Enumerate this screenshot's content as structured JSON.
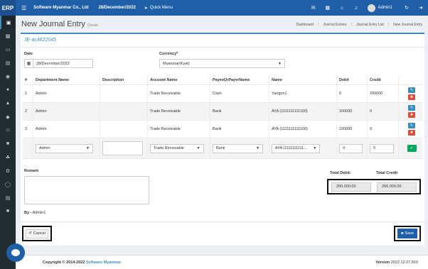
{
  "app": {
    "logo": "ERP",
    "company": "Software Myanmar Co., Ltd",
    "date": "28/December/2022",
    "quick_menu": "Quick Menu",
    "user": "Admin1"
  },
  "page": {
    "title": "New Journal Entry",
    "subtitle": "Create",
    "breadcrumb": [
      "Dashboard",
      "Journal Entries",
      "Journal Entry List",
      "New Journal Entry"
    ]
  },
  "form": {
    "je_code": "JE-ac4622045",
    "date_label": "Date",
    "date_value": "28/December/2022",
    "currency_label": "Currency*",
    "currency_value": "Myanmar(Kyat)"
  },
  "table": {
    "headers": [
      "#",
      "Department Name",
      "Description",
      "Account Name",
      "PayeeOrPayerName",
      "Name",
      "Debit",
      "Credit",
      ""
    ],
    "rows": [
      {
        "no": "1",
        "dept": "Admin",
        "desc": "",
        "account": "Trade Receivable",
        "payee": "Cash",
        "name": "Yangon1",
        "debit": "0",
        "credit": "200000"
      },
      {
        "no": "2",
        "dept": "Admin",
        "desc": "",
        "account": "Trade Receivable",
        "payee": "Bank",
        "name": "AYA (1111111111100)",
        "debit": "100000",
        "credit": "0"
      },
      {
        "no": "3",
        "dept": "Admin",
        "desc": "",
        "account": "Trade Receivable",
        "payee": "Bank",
        "name": "AYA (1111111111100)",
        "debit": "100000",
        "credit": "0"
      }
    ],
    "input_row": {
      "dept": "Admin",
      "account": "Trade Receivable",
      "payee": "Bank",
      "name": "AYA (1111111111...",
      "debit": "0",
      "credit": "0"
    }
  },
  "remark_label": "Remark",
  "totals": {
    "debit_label": "Total Debit:",
    "credit_label": "Total Credit",
    "debit_value": "200,000.00",
    "credit_value": "200,000.00"
  },
  "by": {
    "label": "By -",
    "value": "Admin1"
  },
  "buttons": {
    "cancel": "Cancel",
    "save": "Save"
  },
  "footer": {
    "copyright": "Copyright © 2014-2022",
    "brand": "Software Myanmar.",
    "version_label": "Version",
    "version": "2022.12.27.816"
  },
  "colors": {
    "primary": "#1e5fa8",
    "sidebar": "#222d32",
    "danger": "#dd4b39",
    "success": "#00a65a"
  }
}
